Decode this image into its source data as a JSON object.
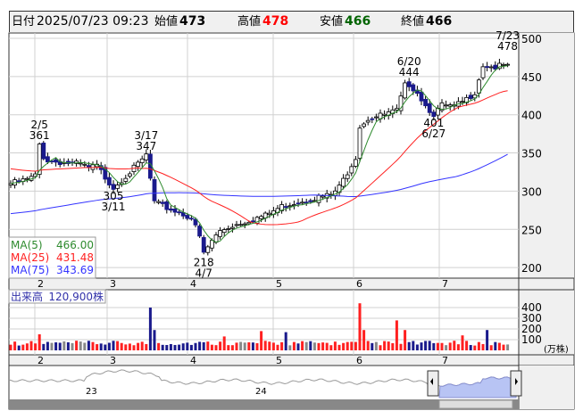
{
  "header": {
    "date_label": "日付",
    "date": "2025/07/23 09:23",
    "open_label": "始値",
    "open": "473",
    "high_label": "高値",
    "high": "478",
    "low_label": "安値",
    "low": "466",
    "close_label": "終値",
    "close": "466",
    "high_color": "#ff0000",
    "low_color": "#006400"
  },
  "legend": {
    "ma5_label": "MA(5)",
    "ma5": "466.00",
    "ma25_label": "MA(25)",
    "ma25": "431.48",
    "ma75_label": "MA(75)",
    "ma75": "343.69"
  },
  "volume": {
    "label": "出来高",
    "value": "120,900株",
    "unit": "(万株)"
  },
  "navigator": {
    "year_labels": [
      "23",
      "24"
    ]
  },
  "chart_data": {
    "type": "candlestick",
    "price_ticks": [
      500,
      450,
      400,
      350,
      300,
      250,
      200
    ],
    "price_range": [
      200,
      500
    ],
    "volume_ticks": [
      400,
      300,
      200,
      100
    ],
    "volume_range": [
      0,
      500
    ],
    "month_labels": [
      "2",
      "3",
      "4",
      "5",
      "6",
      "7"
    ],
    "close_keypoints": [
      [
        0,
        310
      ],
      [
        4,
        315
      ],
      [
        6,
        320
      ],
      [
        7,
        361
      ],
      [
        8,
        345
      ],
      [
        9,
        340
      ],
      [
        12,
        338
      ],
      [
        17,
        335
      ],
      [
        19,
        330
      ],
      [
        21,
        333
      ],
      [
        23,
        318
      ],
      [
        25,
        305
      ],
      [
        28,
        320
      ],
      [
        31,
        335
      ],
      [
        33,
        347
      ],
      [
        35,
        285
      ],
      [
        37,
        280
      ],
      [
        41,
        272
      ],
      [
        44,
        265
      ],
      [
        46,
        240
      ],
      [
        47,
        218
      ],
      [
        49,
        235
      ],
      [
        51,
        248
      ],
      [
        54,
        255
      ],
      [
        58,
        262
      ],
      [
        62,
        268
      ],
      [
        66,
        280
      ],
      [
        69,
        285
      ],
      [
        73,
        290
      ],
      [
        78,
        295
      ],
      [
        80,
        305
      ],
      [
        82,
        325
      ],
      [
        84,
        345
      ],
      [
        85,
        385
      ],
      [
        87,
        395
      ],
      [
        91,
        400
      ],
      [
        94,
        405
      ],
      [
        96,
        438
      ],
      [
        97,
        440
      ],
      [
        99,
        430
      ],
      [
        101,
        412
      ],
      [
        103,
        401
      ],
      [
        105,
        412
      ],
      [
        108,
        410
      ],
      [
        111,
        420
      ],
      [
        113,
        430
      ],
      [
        115,
        465
      ],
      [
        118,
        462
      ],
      [
        121,
        466
      ]
    ],
    "volume_spikes": [
      [
        7,
        150
      ],
      [
        34,
        400
      ],
      [
        35,
        190
      ],
      [
        52,
        130
      ],
      [
        61,
        180
      ],
      [
        67,
        170
      ],
      [
        85,
        440
      ],
      [
        86,
        190
      ],
      [
        94,
        280
      ],
      [
        96,
        190
      ],
      [
        110,
        140
      ],
      [
        116,
        190
      ]
    ],
    "annotations": [
      {
        "date": "2/5",
        "price": "361",
        "i": 7,
        "pos": "above"
      },
      {
        "date": "3/11",
        "price": "305",
        "i": 25,
        "pos": "below"
      },
      {
        "date": "3/17",
        "price": "347",
        "i": 33,
        "pos": "above"
      },
      {
        "date": "4/7",
        "price": "218",
        "i": 47,
        "pos": "below"
      },
      {
        "date": "6/20",
        "price": "444",
        "i": 97,
        "pos": "above"
      },
      {
        "date": "6/27",
        "price": "401",
        "i": 103,
        "pos": "below"
      },
      {
        "date": "7/23",
        "price": "478",
        "i": 121,
        "pos": "above"
      }
    ],
    "ma_colors": {
      "ma5": "#2e8b2e",
      "ma25": "#ff2020",
      "ma75": "#3333ff"
    }
  }
}
